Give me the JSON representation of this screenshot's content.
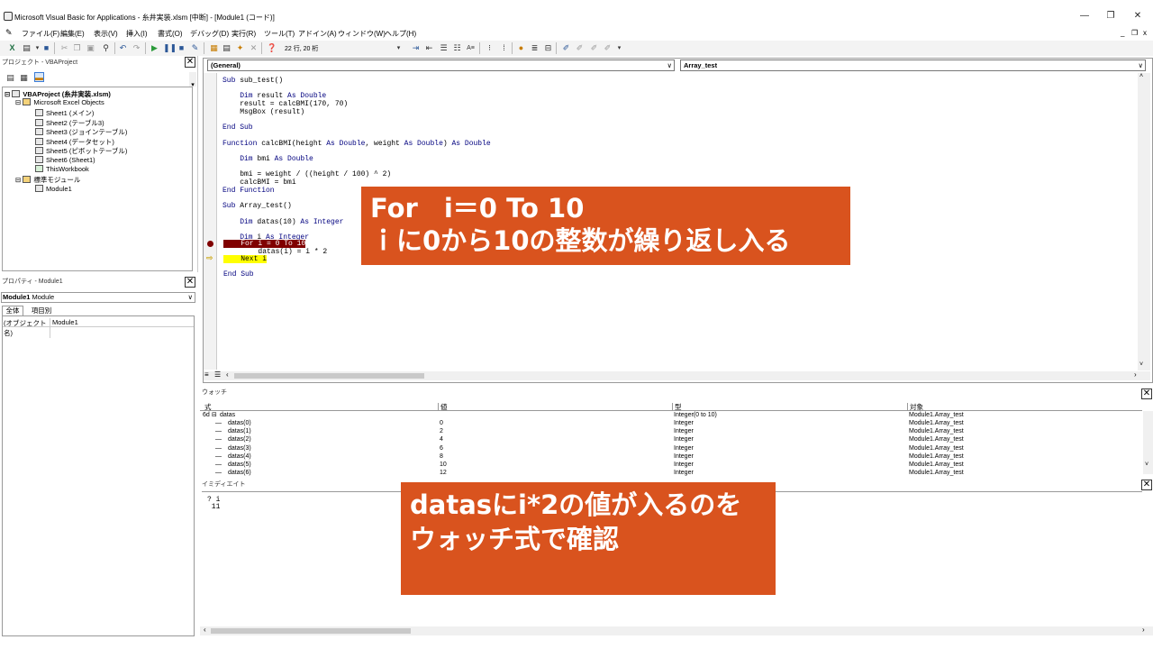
{
  "window": {
    "title": "Microsoft Visual Basic for Applications - 糸井実装.xlsm [中断] - [Module1 (コード)]",
    "minimize": "—",
    "restore": "❐",
    "close": "✕",
    "mdi_min": "_",
    "mdi_restore": "❐",
    "mdi_close": "x"
  },
  "menu": {
    "items": [
      "ファイル(F)",
      "編集(E)",
      "表示(V)",
      "挿入(I)",
      "書式(O)",
      "デバッグ(D)",
      "実行(R)",
      "ツール(T)",
      "アドイン(A)",
      "ウィンドウ(W)",
      "ヘルプ(H)"
    ]
  },
  "toolbar": {
    "position": "22 行, 20 桁"
  },
  "project": {
    "title": "プロジェクト - VBAProject",
    "close": "✕",
    "root": "VBAProject (糸井実装.xlsm)",
    "folder_excel": "Microsoft Excel Objects",
    "sheets": [
      "Sheet1 (メイン)",
      "Sheet2 (テーブル3)",
      "Sheet3 (ジョインテーブル)",
      "Sheet4 (データセット)",
      "Sheet5 (ピボットテーブル)",
      "Sheet6 (Sheet1)",
      "ThisWorkbook"
    ],
    "folder_modules": "標準モジュール",
    "module": "Module1"
  },
  "properties": {
    "title": "プロパティ - Module1",
    "close": "✕",
    "object_select": "Module1",
    "object_type": "Module",
    "tab_all": "全体",
    "tab_category": "項目別",
    "prop_name": "(オブジェクト名)",
    "prop_value": "Module1"
  },
  "code": {
    "object_combo": "(General)",
    "proc_combo": "Array_test",
    "lines": [
      [
        "Sub",
        " sub_test()"
      ],
      [
        "",
        ""
      ],
      [
        "    ",
        "Dim",
        " result ",
        "As Double"
      ],
      [
        "    ",
        "",
        "result = calcBMI(170, 70)"
      ],
      [
        "    ",
        "",
        "MsgBox (result)"
      ],
      [
        "",
        ""
      ],
      [
        "End Sub",
        ""
      ],
      [
        "",
        ""
      ],
      [
        "Function",
        " calcBMI(height ",
        "As Double",
        ", weight ",
        "As Double",
        ") ",
        "As Double"
      ],
      [
        "",
        ""
      ],
      [
        "    ",
        "Dim",
        " bmi ",
        "As Double"
      ],
      [
        "",
        ""
      ],
      [
        "    ",
        "",
        "bmi = weight / ((height / 100) ^ 2)"
      ],
      [
        "    ",
        "",
        "calcBMI = bmi"
      ],
      [
        "End Function",
        ""
      ],
      [
        "",
        ""
      ],
      [
        "Sub",
        " Array_test()"
      ],
      [
        "",
        ""
      ],
      [
        "    ",
        "Dim",
        " datas(10) ",
        "As Integer"
      ],
      [
        "",
        ""
      ],
      [
        "    ",
        "Dim",
        " i ",
        "As Integer"
      ]
    ],
    "line_for": "    For i = 0 To 10",
    "line_assign": "        datas(i) = i * 2",
    "line_next": "    Next i",
    "line_blank": "",
    "line_endsub": "End Sub"
  },
  "watch": {
    "title": "ウォッチ",
    "close": "✕",
    "headers": [
      "式",
      "値",
      "型",
      "対象"
    ],
    "parent": {
      "prefix": "6d",
      "expr": "datas",
      "value": "",
      "type": "Integer(0 to 10)",
      "context": "Module1.Array_test"
    },
    "rows": [
      {
        "expr": "datas(0)",
        "value": "0",
        "type": "Integer",
        "context": "Module1.Array_test"
      },
      {
        "expr": "datas(1)",
        "value": "2",
        "type": "Integer",
        "context": "Module1.Array_test"
      },
      {
        "expr": "datas(2)",
        "value": "4",
        "type": "Integer",
        "context": "Module1.Array_test"
      },
      {
        "expr": "datas(3)",
        "value": "6",
        "type": "Integer",
        "context": "Module1.Array_test"
      },
      {
        "expr": "datas(4)",
        "value": "8",
        "type": "Integer",
        "context": "Module1.Array_test"
      },
      {
        "expr": "datas(5)",
        "value": "10",
        "type": "Integer",
        "context": "Module1.Array_test"
      },
      {
        "expr": "datas(6)",
        "value": "12",
        "type": "Integer",
        "context": "Module1.Array_test"
      }
    ]
  },
  "immediate": {
    "title": "イミディエイト",
    "close": "✕",
    "line1": "? i",
    "line2": " 11"
  },
  "callouts": {
    "top_line1": "For　i＝0 To 10",
    "top_line2": "ｉに0から10の整数が繰り返し入る",
    "bottom_line1": "datasにi*2の値が入るのを",
    "bottom_line2": "ウォッチ式で確認"
  },
  "colors": {
    "callout": "#d9531e",
    "breakpoint": "#800000",
    "current_line": "#ffff00",
    "keyword": "#00007f"
  }
}
